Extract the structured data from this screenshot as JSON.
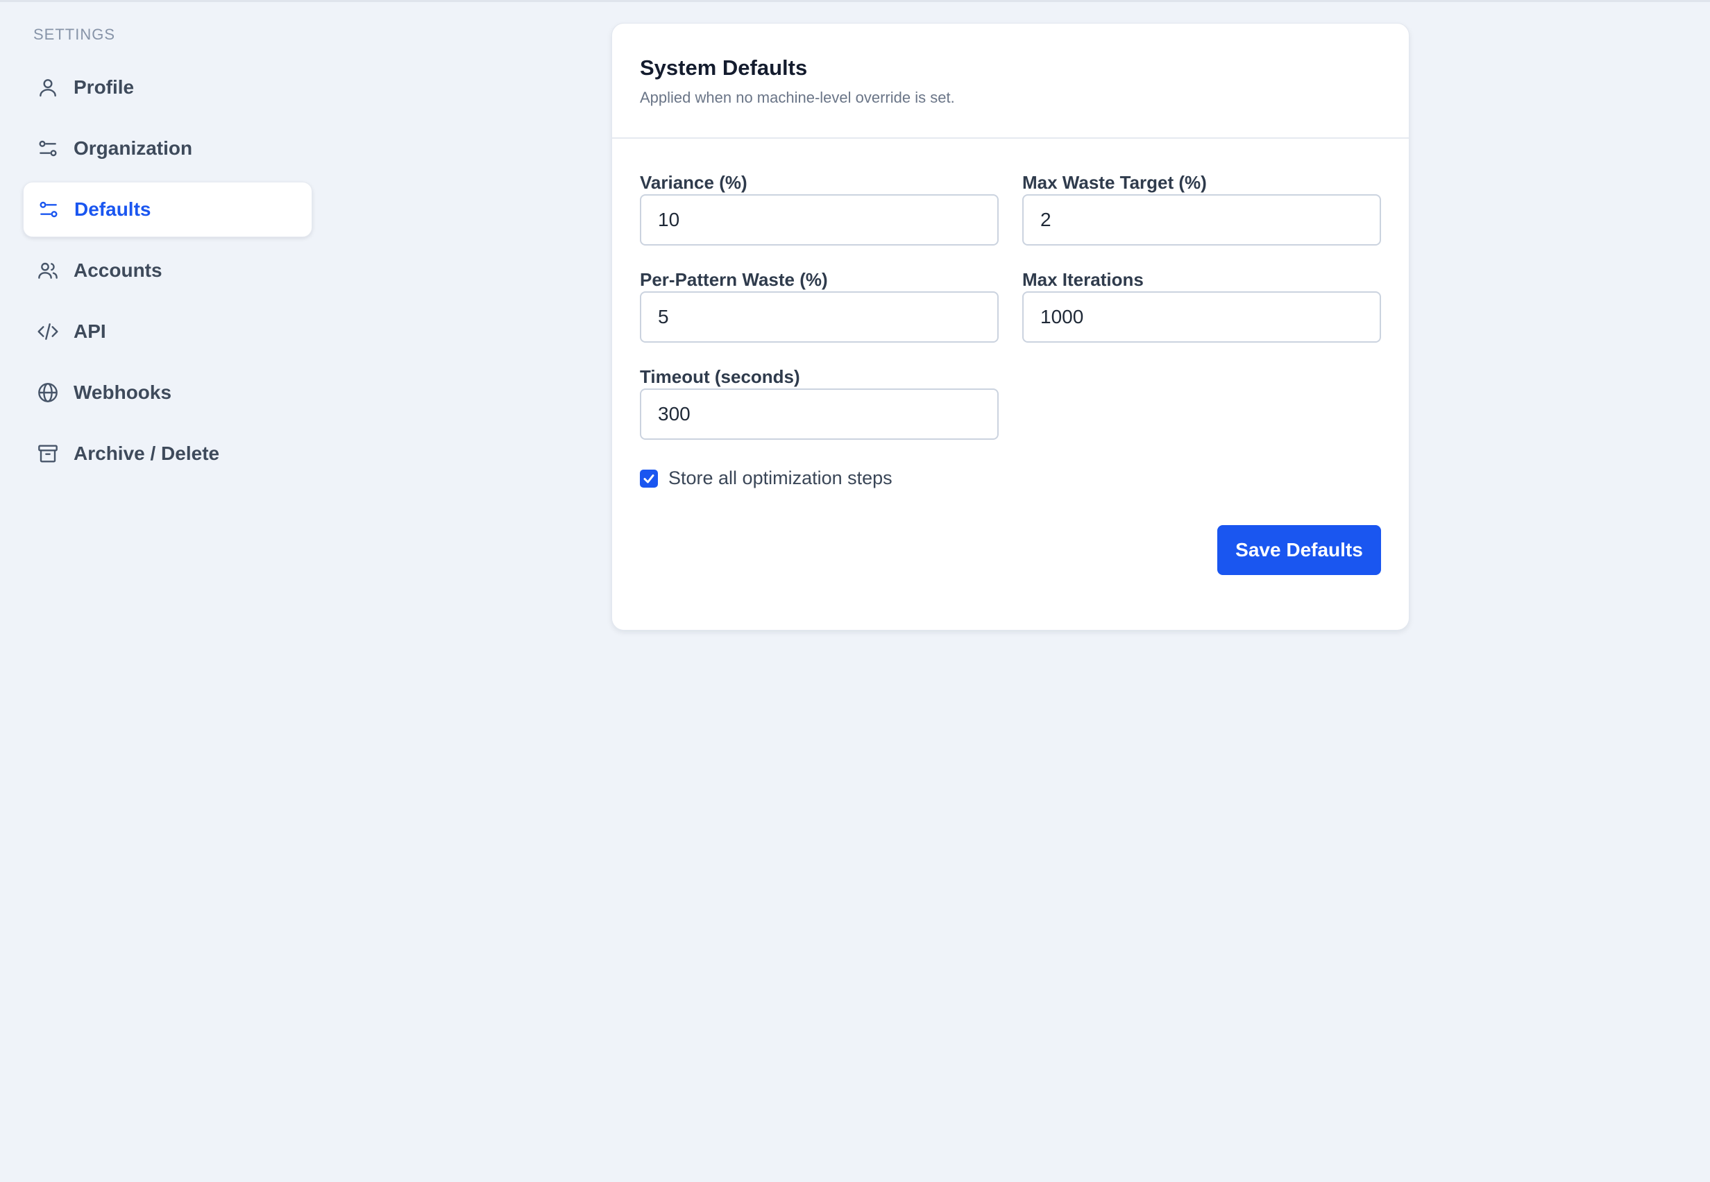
{
  "sidebar": {
    "heading": "SETTINGS",
    "items": [
      {
        "label": "Profile",
        "icon": "user-icon"
      },
      {
        "label": "Organization",
        "icon": "sliders-icon"
      },
      {
        "label": "Defaults",
        "icon": "sliders-icon",
        "active": true
      },
      {
        "label": "Accounts",
        "icon": "users-icon"
      },
      {
        "label": "API",
        "icon": "code-icon"
      },
      {
        "label": "Webhooks",
        "icon": "globe-icon"
      },
      {
        "label": "Archive / Delete",
        "icon": "archive-icon"
      }
    ]
  },
  "card": {
    "title": "System Defaults",
    "subtitle": "Applied when no machine-level override is set.",
    "fields": {
      "variance": {
        "label": "Variance (%)",
        "value": "10"
      },
      "max_waste_target": {
        "label": "Max Waste Target (%)",
        "value": "2"
      },
      "per_pattern_waste": {
        "label": "Per-Pattern Waste (%)",
        "value": "5"
      },
      "max_iterations": {
        "label": "Max Iterations",
        "value": "1000"
      },
      "timeout": {
        "label": "Timeout (seconds)",
        "value": "300"
      }
    },
    "store_steps": {
      "label": "Store all optimization steps",
      "checked": true
    },
    "save_label": "Save Defaults"
  },
  "colors": {
    "accent": "#1a56f0",
    "background": "#eff3f9",
    "card": "#ffffff"
  }
}
